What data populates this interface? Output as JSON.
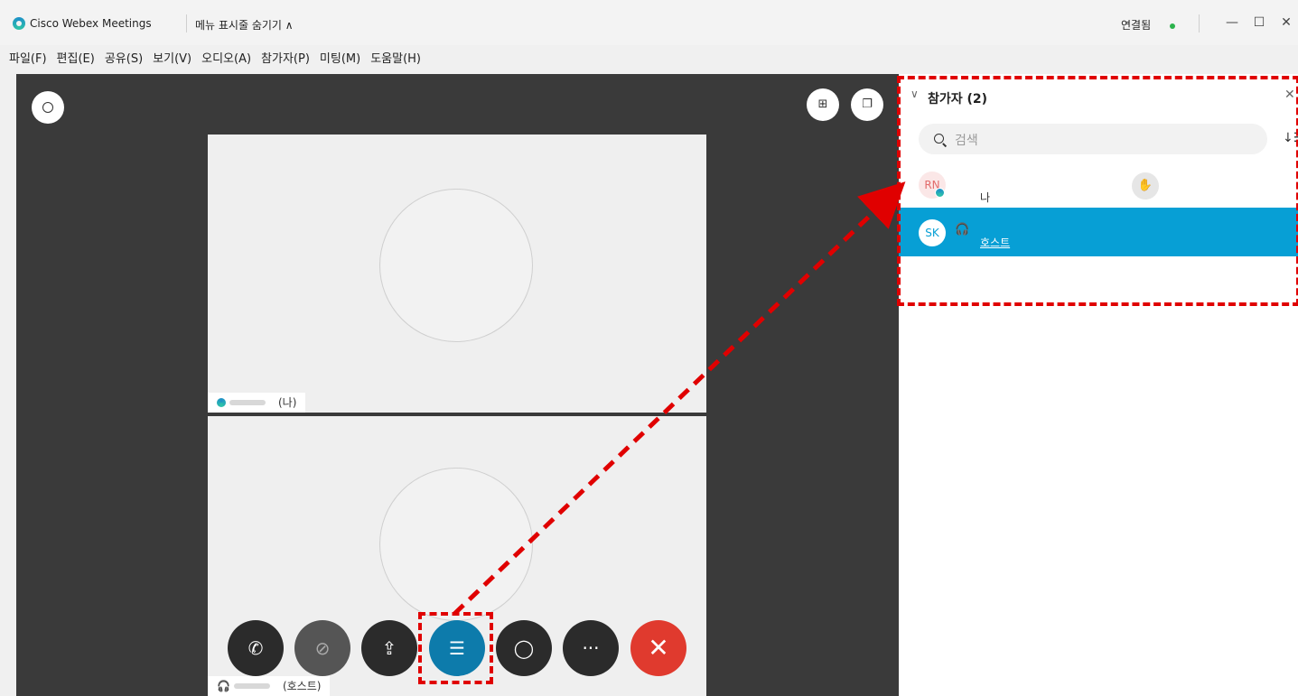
{
  "titlebar": {
    "app_name": "Cisco Webex Meetings",
    "menu_toggle": "메뉴 표시줄 숨기기 ∧",
    "status": "연결됨",
    "minimize": "—",
    "maximize": "☐",
    "close": "✕"
  },
  "menubar": {
    "items": [
      "파일(F)",
      "편집(E)",
      "공유(S)",
      "보기(V)",
      "오디오(A)",
      "참가자(P)",
      "미팅(M)",
      "도움말(H)"
    ]
  },
  "stage": {
    "tiles": [
      {
        "suffix": "(나)"
      },
      {
        "suffix": "(호스트)"
      }
    ],
    "top_right_buttons": [
      "grid-view-icon",
      "restore-window-icon"
    ]
  },
  "controls": {
    "buttons": [
      {
        "name": "audio-button",
        "icon": "phone-icon",
        "glyph": "✆"
      },
      {
        "name": "video-button",
        "icon": "camera-off-icon",
        "glyph": "⊘"
      },
      {
        "name": "share-button",
        "icon": "share-icon",
        "glyph": "⇪"
      },
      {
        "name": "participants-button",
        "icon": "participants-icon",
        "glyph": "☰"
      },
      {
        "name": "chat-button",
        "icon": "chat-icon",
        "glyph": "◯"
      },
      {
        "name": "more-button",
        "icon": "more-icon",
        "glyph": "···"
      },
      {
        "name": "leave-button",
        "icon": "close-icon",
        "glyph": "✕"
      }
    ]
  },
  "panel": {
    "collapse_glyph": "∨",
    "title": "참가자 (2)",
    "close_glyph": "✕",
    "search_placeholder": "검색",
    "sort_glyph": "↓☰",
    "participants": [
      {
        "initials": "RN",
        "role": "나",
        "raise_hand_glyph": "✋"
      },
      {
        "initials": "SK",
        "role": "호스트",
        "audio_glyph": "🎧"
      }
    ]
  },
  "colors": {
    "stage_bg": "#3a3a3a",
    "selected_row": "#079fd5",
    "participants_button": "#0d7bab",
    "end_button": "#e03a2e",
    "annotation": "#e00000",
    "connected_dot": "#2bb24c"
  }
}
